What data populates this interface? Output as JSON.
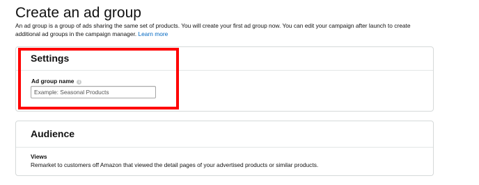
{
  "page": {
    "title": "Create an ad group",
    "description": "An ad group is a group of ads sharing the same set of products. You will create your first ad group now. You can edit your campaign after launch to create additional ad groups in the campaign manager.",
    "learn_more": "Learn more"
  },
  "settings": {
    "title": "Settings",
    "ad_group_name_label": "Ad group name",
    "info_icon": "info-icon",
    "ad_group_name_placeholder": "Example: Seasonal Products",
    "ad_group_name_value": ""
  },
  "audience": {
    "title": "Audience",
    "views_label": "Views",
    "views_description": "Remarket to customers off Amazon that viewed the detail pages of your advertised products or similar products."
  },
  "colors": {
    "highlight": "#ff0000",
    "link": "#0066c0",
    "card_border": "#d5d9d9"
  }
}
